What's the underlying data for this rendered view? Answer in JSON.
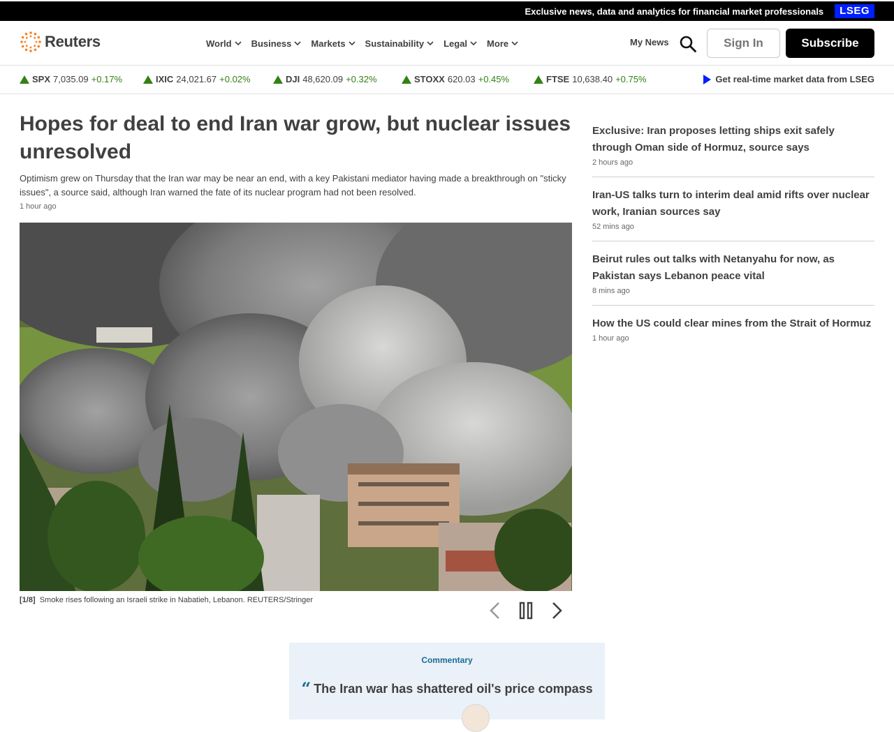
{
  "promo": {
    "text": "Exclusive news, data and analytics for financial market professionals",
    "badge": "LSEG"
  },
  "header": {
    "brand": "Reuters",
    "nav": [
      {
        "label": "World"
      },
      {
        "label": "Business"
      },
      {
        "label": "Markets"
      },
      {
        "label": "Sustainability"
      },
      {
        "label": "Legal"
      },
      {
        "label": "More"
      }
    ],
    "my_news": "My News",
    "sign_in": "Sign In",
    "subscribe": "Subscribe"
  },
  "ticker": {
    "items": [
      {
        "symbol": "SPX",
        "value": "7,035.09",
        "change": "+0.17%"
      },
      {
        "symbol": "IXIC",
        "value": "24,021.67",
        "change": "+0.02%"
      },
      {
        "symbol": "DJI",
        "value": "48,620.09",
        "change": "+0.32%"
      },
      {
        "symbol": "STOXX",
        "value": "620.03",
        "change": "+0.45%"
      },
      {
        "symbol": "FTSE",
        "value": "10,638.40",
        "change": "+0.75%"
      }
    ],
    "lseg_link": "Get real-time market data from LSEG"
  },
  "main": {
    "headline": "Hopes for deal to end Iran war grow, but nuclear issues unresolved",
    "summary": "Optimism grew on Thursday that the Iran war may be near an end, with a key Pakistani mediator having made a breakthrough on \"sticky issues\", a source said, although Iran warned the fate of its nuclear program had not been resolved.",
    "time": "1 hour ago",
    "caption_index": "[1/8]",
    "caption": "Smoke rises following an Israeli strike in Nabatieh, Lebanon. REUTERS/Stringer"
  },
  "sidebar": {
    "stories": [
      {
        "title": "Exclusive: Iran proposes letting ships exit safely through Oman side of Hormuz, source says",
        "time": "2 hours ago"
      },
      {
        "title": "Iran-US talks turn to interim deal amid rifts over nuclear work, Iranian sources say",
        "time": "52 mins ago"
      },
      {
        "title": "Beirut rules out talks with Netanyahu for now, as Pakistan says Lebanon peace vital",
        "time": "8 mins ago"
      },
      {
        "title": "How the US could clear mines from the Strait of Hormuz",
        "time": "1 hour ago"
      }
    ]
  },
  "commentary": {
    "label": "Commentary",
    "title": "The Iran war has shattered oil's price compass"
  },
  "colors": {
    "market_up": "#328114",
    "lseg_blue": "#001eff",
    "brand_orange": "#fb8024",
    "commentary_bg": "#eaf1f8"
  }
}
